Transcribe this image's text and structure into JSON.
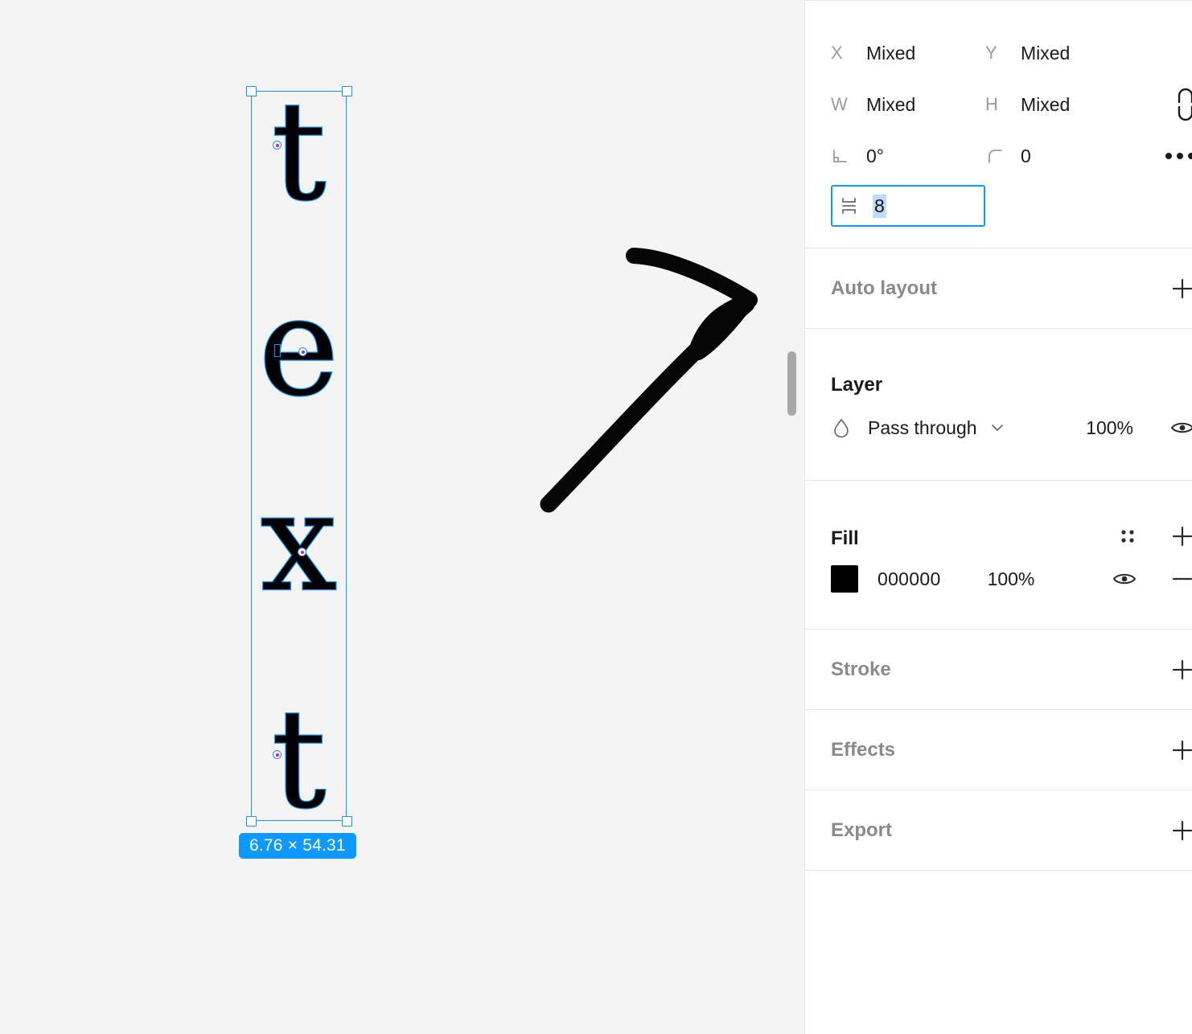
{
  "canvas": {
    "selection": {
      "glyphs": [
        "t",
        "e",
        "x",
        "t"
      ],
      "dimension_badge": "6.76 × 54.31"
    },
    "annotation": {
      "arrow_name": "hand-drawn-arrow"
    },
    "background_color": "#f4f4f4",
    "selection_color": "#0d99ff"
  },
  "panel": {
    "properties": {
      "x": {
        "label": "X",
        "value": "Mixed"
      },
      "y": {
        "label": "Y",
        "value": "Mixed"
      },
      "w": {
        "label": "W",
        "value": "Mixed"
      },
      "h": {
        "label": "H",
        "value": "Mixed"
      },
      "rotation": {
        "value": "0°"
      },
      "corner_radius": {
        "value": "0"
      },
      "spacing": {
        "value": "8"
      }
    },
    "auto_layout": {
      "title": "Auto layout",
      "add_label": "+"
    },
    "layer": {
      "title": "Layer",
      "blend_mode": "Pass through",
      "opacity": "100%"
    },
    "fill": {
      "title": "Fill",
      "items": [
        {
          "hex": "000000",
          "opacity": "100%",
          "color": "#000000"
        }
      ]
    },
    "stroke": {
      "title": "Stroke"
    },
    "effects": {
      "title": "Effects"
    },
    "export": {
      "title": "Export"
    }
  }
}
